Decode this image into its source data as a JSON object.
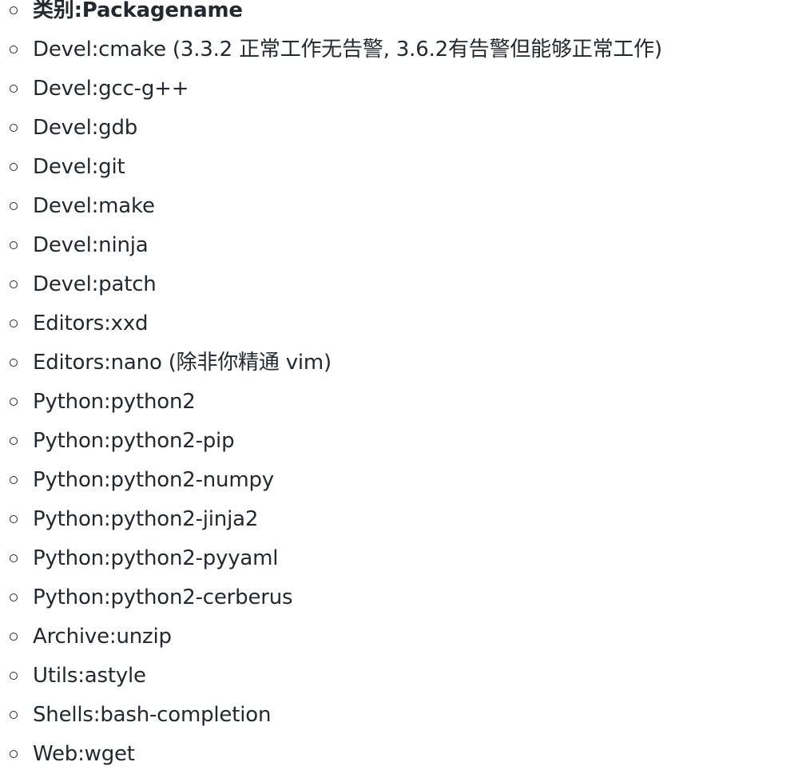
{
  "package_list": {
    "header": "类别:Packagename",
    "items": [
      "Devel:cmake (3.3.2 正常工作无告警, 3.6.2有告警但能够正常工作)",
      "Devel:gcc-g++",
      "Devel:gdb",
      "Devel:git",
      "Devel:make",
      "Devel:ninja",
      "Devel:patch",
      "Editors:xxd",
      "Editors:nano (除非你精通 vim)",
      "Python:python2",
      "Python:python2-pip",
      "Python:python2-numpy",
      "Python:python2-jinja2",
      "Python:python2-pyyaml",
      "Python:python2-cerberus",
      "Archive:unzip",
      "Utils:astyle",
      "Shells:bash-completion",
      "Web:wget"
    ]
  }
}
